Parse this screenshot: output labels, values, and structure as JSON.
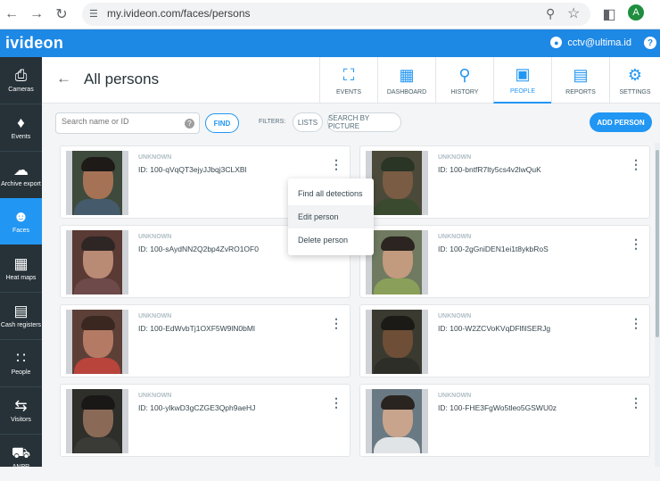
{
  "browser": {
    "url": "my.ivideon.com/faces/persons",
    "profile_initial": "A"
  },
  "app": {
    "brand": "ivideon",
    "user_email": "cctv@ultima.id",
    "help": "?"
  },
  "sidebar": {
    "items": [
      {
        "label": "Cameras",
        "icon": "camera-icon"
      },
      {
        "label": "Events",
        "icon": "bell-icon"
      },
      {
        "label": "Archive export",
        "icon": "cloud-download-icon"
      },
      {
        "label": "Faces",
        "icon": "face-scan-icon"
      },
      {
        "label": "Heat maps",
        "icon": "heatmap-icon"
      },
      {
        "label": "Cash registers",
        "icon": "cash-register-icon"
      },
      {
        "label": "People",
        "icon": "people-grid-icon"
      },
      {
        "label": "Visitors",
        "icon": "arrows-icon"
      },
      {
        "label": "ANPR",
        "icon": "car-icon"
      }
    ],
    "active": "Faces"
  },
  "header": {
    "title": "All persons",
    "tabs": [
      {
        "label": "EVENTS",
        "icon": "face-scan-icon"
      },
      {
        "label": "DASHBOARD",
        "icon": "dashboard-icon"
      },
      {
        "label": "HISTORY",
        "icon": "search-icon"
      },
      {
        "label": "PEOPLE",
        "icon": "portrait-icon"
      },
      {
        "label": "REPORTS",
        "icon": "report-icon"
      },
      {
        "label": "SETTINGS",
        "icon": "gear-icon"
      }
    ],
    "active_tab": "PEOPLE"
  },
  "toolbar": {
    "search_placeholder": "Search name or ID",
    "find_label": "FIND",
    "filters_label": "FILTERS:",
    "lists_label": "LISTS",
    "search_by_picture_label": "SEARCH BY PICTURE",
    "add_person_label": "ADD PERSON"
  },
  "persons": [
    {
      "status": "UNKNOWN",
      "id": "ID: 100-qVqQT3ejyJJbqj3CLXBl",
      "bg": "#3e4a3c",
      "skin": "#a57256",
      "hair": "#1d1a18",
      "shirt": "#455a6a"
    },
    {
      "status": "UNKNOWN",
      "id": "ID: 100-bntfR7lty5cs4v2lwQuK",
      "bg": "#4b4a3a",
      "skin": "#7a5b43",
      "hair": "#2a3526",
      "shirt": "#3a4a2f"
    },
    {
      "status": "UNKNOWN",
      "id": "ID: 100-sAydNN2Q2bp4ZvRO1OF0",
      "bg": "#5a3a34",
      "skin": "#b98a74",
      "hair": "#2e2624",
      "shirt": "#6e4a4a"
    },
    {
      "status": "UNKNOWN",
      "id": "ID: 100-2gGniDEN1ei1t8ykbRoS",
      "bg": "#6f7a60",
      "skin": "#c29a7d",
      "hair": "#2b2420",
      "shirt": "#8aa05a"
    },
    {
      "status": "UNKNOWN",
      "id": "ID: 100-EdWvbTj1OXF5W9lN0bMl",
      "bg": "#5c4038",
      "skin": "#b47a64",
      "hair": "#3a2820",
      "shirt": "#b8443c"
    },
    {
      "status": "UNKNOWN",
      "id": "ID: 100-W2ZCVoKVqDFlfilSERJg",
      "bg": "#3a3a30",
      "skin": "#6e4e36",
      "hair": "#1c1a16",
      "shirt": "#2e2e28"
    },
    {
      "status": "UNKNOWN",
      "id": "ID: 100-ylkwD3gCZGE3Qph9aeHJ",
      "bg": "#2e2e2a",
      "skin": "#8a6a56",
      "hair": "#1a1816",
      "shirt": "#3a3a36"
    },
    {
      "status": "UNKNOWN",
      "id": "ID: 100-FHE3FgWo5tleo5GSWU0z",
      "bg": "#6a7a84",
      "skin": "#c8a48c",
      "hair": "#2a2420",
      "shirt": "#e0e4e6"
    }
  ],
  "context_menu": {
    "items": [
      "Find all detections",
      "Edit person",
      "Delete person"
    ],
    "hovered": "Edit person"
  },
  "colors": {
    "brand_blue": "#1e88e5",
    "accent": "#2196f3",
    "sidebar": "#263238"
  }
}
